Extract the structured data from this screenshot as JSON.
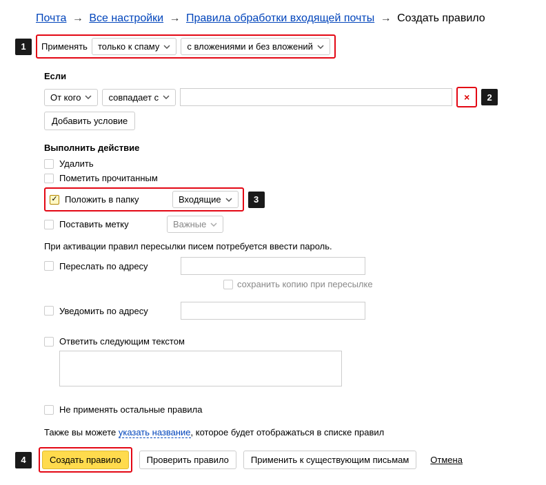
{
  "breadcrumbs": {
    "mail": "Почта",
    "all_settings": "Все настройки",
    "incoming_rules": "Правила обработки входящей почты",
    "create_rule": "Создать правило"
  },
  "apply": {
    "label": "Применять",
    "spam_option": "только к спаму",
    "attachments_option": "с вложениями и без вложений"
  },
  "conditions": {
    "title": "Если",
    "from": "От кого",
    "matches": "совпадает с",
    "value": "",
    "add_condition": "Добавить условие"
  },
  "actions": {
    "title": "Выполнить действие",
    "delete": "Удалить",
    "mark_read": "Пометить прочитанным",
    "move_to_folder": "Положить в папку",
    "folder_value": "Входящие",
    "set_label": "Поставить метку",
    "label_value": "Важные"
  },
  "forward": {
    "note": "При активации правил пересылки писем потребуется ввести пароль.",
    "forward_to": "Переслать по адресу",
    "save_copy": "сохранить копию при пересылке",
    "notify_to": "Уведомить по адресу",
    "reply_with": "Ответить следующим текстом"
  },
  "skip_other": "Не применять остальные правила",
  "name_hint": {
    "prefix": "Также вы можете ",
    "link": "указать название",
    "suffix": ", которое будет отображаться в списке правил"
  },
  "buttons": {
    "create": "Создать правило",
    "check": "Проверить правило",
    "apply_existing": "Применить к существующим письмам",
    "cancel": "Отмена"
  },
  "callouts": {
    "c1": "1",
    "c2": "2",
    "c3": "3",
    "c4": "4"
  }
}
